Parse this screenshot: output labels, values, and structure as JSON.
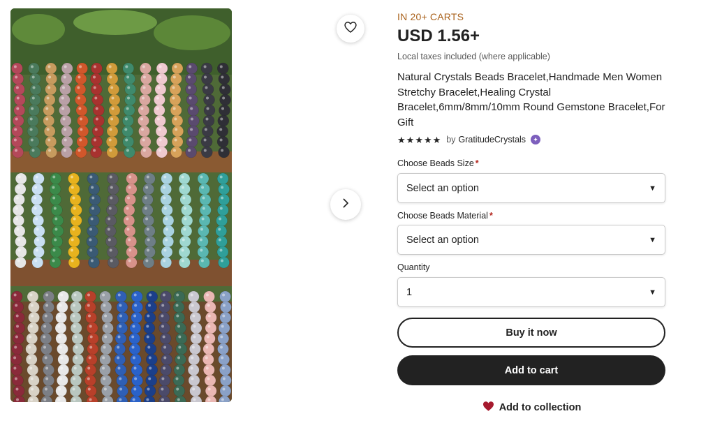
{
  "media": {
    "photo_alt": "",
    "favorite_icon": "heart-outline-icon",
    "next_icon": "chevron-right-icon"
  },
  "listing": {
    "badge": "IN 20+ CARTS",
    "price": "USD 1.56+",
    "taxes_note": "Local taxes included (where applicable)",
    "title": "Natural Crystals Beads Bracelet,Handmade Men Women Stretchy Bracelet,Healing Crystal Bracelet,6mm/8mm/10mm Round Gemstone Bracelet,For Gift",
    "rating_stars": 5,
    "seller_prefix": "by",
    "seller_name": "GratitudeCrystals"
  },
  "options": {
    "size": {
      "label": "Choose Beads Size",
      "required_mark": "*",
      "value": "Select an option"
    },
    "material": {
      "label": "Choose Beads Material",
      "required_mark": "*",
      "value": "Select an option"
    },
    "quantity": {
      "label": "Quantity",
      "value": "1"
    }
  },
  "actions": {
    "buy_now": "Buy it now",
    "add_to_cart": "Add to cart",
    "add_to_collection": "Add to collection"
  },
  "colors": {
    "badge": "#a9611b",
    "primary_button": "#222222",
    "star_seller_badge": "#7d5fbd",
    "collection_heart": "#a61a2e",
    "required": "#b3261e"
  }
}
